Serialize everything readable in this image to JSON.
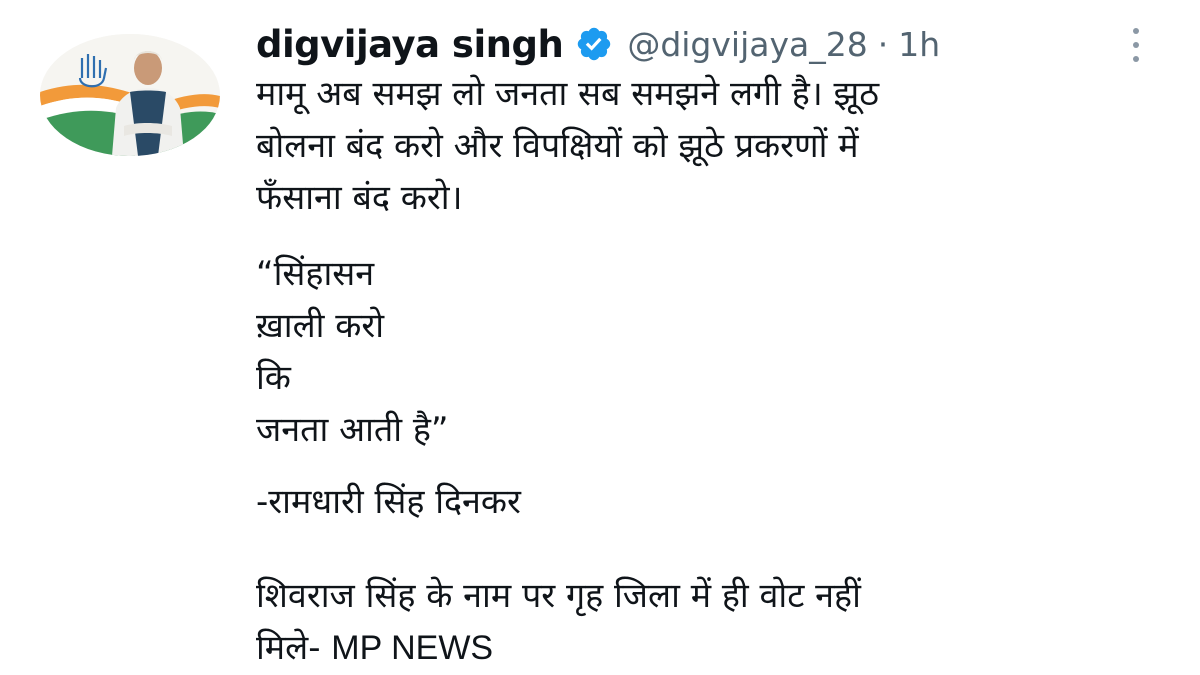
{
  "tweet": {
    "display_name": "digvijaya singh",
    "handle": "@digvijaya_28",
    "separator": "·",
    "time": "1h",
    "paragraph1": [
      "मामू अब समझ लो जनता सब समझने लगी है। झूठ",
      "बोलना बंद करो और विपक्षियों को झूठे प्रकरणों में",
      "फँसाना बंद करो।"
    ],
    "quote": [
      "“सिंहासन",
      "ख़ाली करो",
      "कि",
      "जनता आती है”"
    ],
    "attribution": "-रामधारी सिंह दिनकर",
    "news_line1": "शिवराज सिंह के नाम पर गृह जिला में ही वोट नहीं",
    "news_line2_hi": "मिले-",
    "news_line2_en": "MP NEWS"
  },
  "icons": {
    "verified": "verified-badge-icon",
    "more": "more-options-icon"
  },
  "colors": {
    "text": "#0f1419",
    "secondary": "#536471",
    "verified_blue": "#1d9bf0",
    "saffron": "#f29a3a",
    "green": "#2e8b57"
  }
}
